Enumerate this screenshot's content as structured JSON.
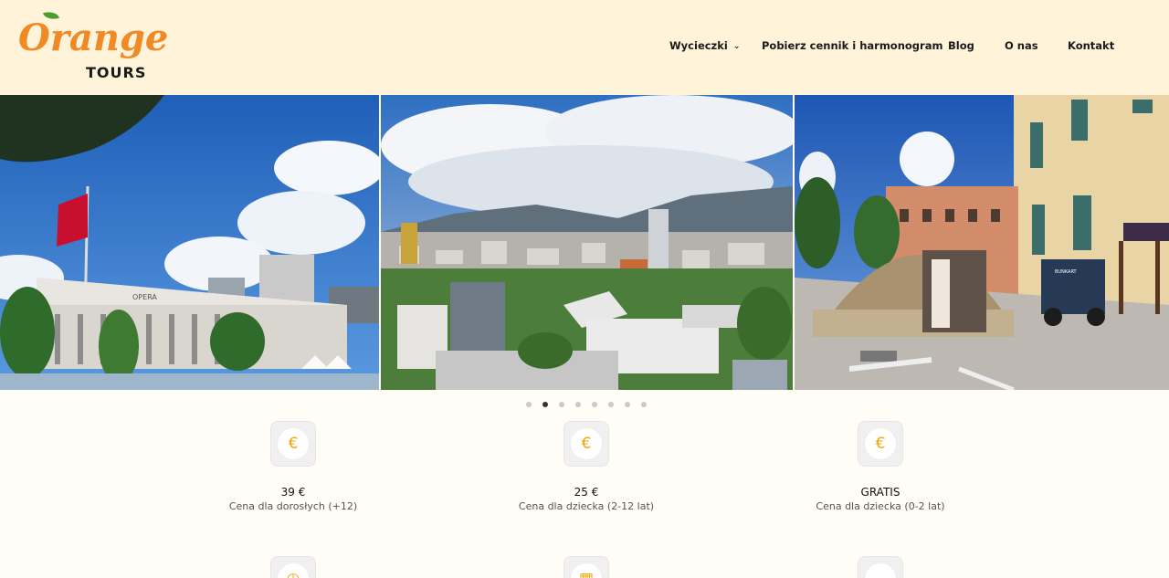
{
  "brand": {
    "name_top": "Orange",
    "name_bottom": "TOURS"
  },
  "nav": {
    "items": [
      {
        "label": "Wycieczki",
        "has_dropdown": true
      },
      {
        "label": "Pobierz cennik i harmonogram"
      },
      {
        "label": "Blog"
      },
      {
        "label": "O nas"
      },
      {
        "label": "Kontakt"
      }
    ]
  },
  "gallery": {
    "photos": [
      {
        "subject": "opera-building-photo",
        "sign": "OPERA"
      },
      {
        "subject": "city-panorama-photo"
      },
      {
        "subject": "bunker-dome-photo",
        "sign": "BUNKART"
      }
    ],
    "slides_count": 8,
    "active_slide": 2
  },
  "pricing": [
    {
      "icon": "euro-icon",
      "symbol": "€",
      "price": "39 €",
      "label": "Cena dla dorosłych (+12)"
    },
    {
      "icon": "euro-icon",
      "symbol": "€",
      "price": "25 €",
      "label": "Cena dla dziecka (2-12 lat)"
    },
    {
      "icon": "euro-icon",
      "symbol": "€",
      "price": "GRATIS",
      "label": "Cena dla dziecka (0-2 lat)"
    }
  ],
  "colors": {
    "accent": "#f08a24",
    "header_bg": "#fff3da",
    "euro": "#f0a300"
  }
}
